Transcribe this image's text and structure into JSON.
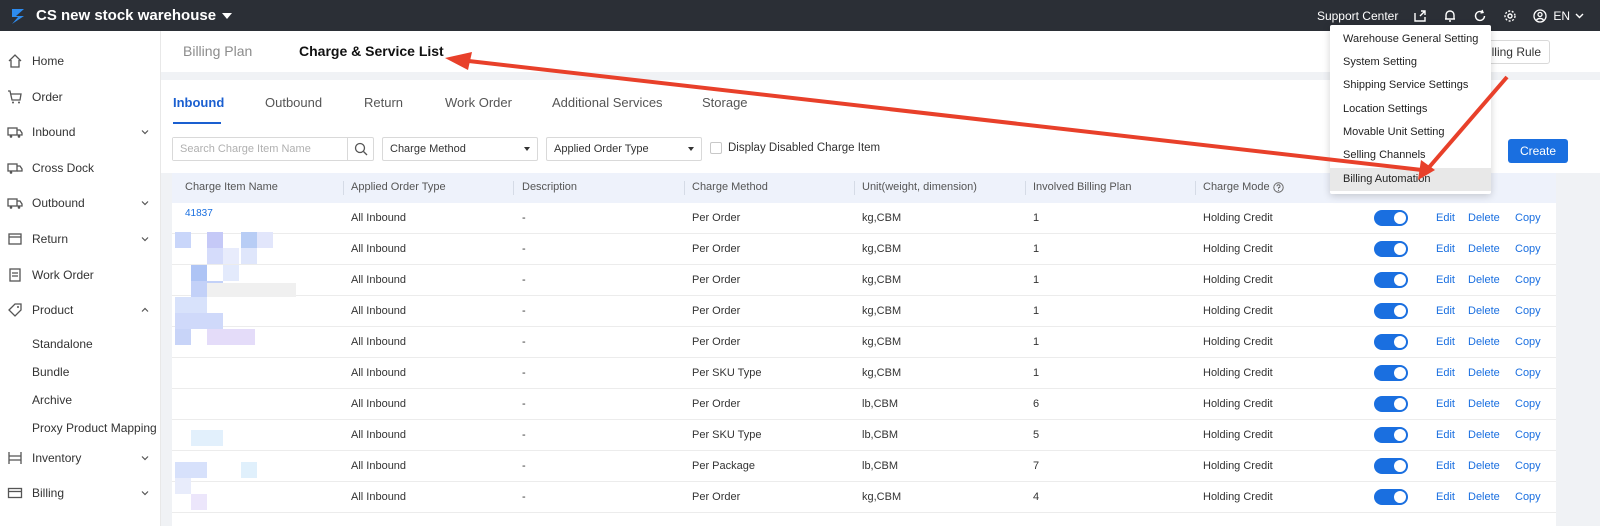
{
  "topbar": {
    "warehouse": "CS new stock warehouse",
    "support": "Support Center",
    "lang": "EN"
  },
  "sidebar": {
    "items": [
      {
        "label": "Home"
      },
      {
        "label": "Order"
      },
      {
        "label": "Inbound"
      },
      {
        "label": "Cross Dock"
      },
      {
        "label": "Outbound"
      },
      {
        "label": "Return"
      },
      {
        "label": "Work Order"
      },
      {
        "label": "Product"
      },
      {
        "label": "Inventory"
      },
      {
        "label": "Billing"
      }
    ],
    "product_sub": [
      "Standalone",
      "Bundle",
      "Archive",
      "Proxy Product Mapping"
    ]
  },
  "subhead": {
    "billing_plan": "Billing Plan",
    "charge_list": "Charge & Service List",
    "billing_rule": "Billing Rule"
  },
  "tabs": [
    "Inbound",
    "Outbound",
    "Return",
    "Work Order",
    "Additional Services",
    "Storage"
  ],
  "filters": {
    "search_placeholder": "Search Charge Item Name",
    "charge_method": "Charge Method",
    "applied_order_type": "Applied Order Type",
    "display_disabled": "Display Disabled Charge Item",
    "create": "Create"
  },
  "table": {
    "headers": [
      "Charge Item Name",
      "Applied Order Type",
      "Description",
      "Charge Method",
      "Unit(weight, dimension)",
      "Involved Billing Plan",
      "Charge Mode"
    ],
    "first_name": "41837",
    "actions": {
      "edit": "Edit",
      "delete": "Delete",
      "copy": "Copy"
    },
    "rows": [
      {
        "type": "All Inbound",
        "desc": "-",
        "method": "Per Order",
        "unit": "kg,CBM",
        "plans": "1",
        "mode": "Holding Credit"
      },
      {
        "type": "All Inbound",
        "desc": "-",
        "method": "Per Order",
        "unit": "kg,CBM",
        "plans": "1",
        "mode": "Holding Credit"
      },
      {
        "type": "All Inbound",
        "desc": "-",
        "method": "Per Order",
        "unit": "kg,CBM",
        "plans": "1",
        "mode": "Holding Credit"
      },
      {
        "type": "All Inbound",
        "desc": "-",
        "method": "Per Order",
        "unit": "kg,CBM",
        "plans": "1",
        "mode": "Holding Credit"
      },
      {
        "type": "All Inbound",
        "desc": "-",
        "method": "Per Order",
        "unit": "kg,CBM",
        "plans": "1",
        "mode": "Holding Credit"
      },
      {
        "type": "All Inbound",
        "desc": "-",
        "method": "Per SKU Type",
        "unit": "kg,CBM",
        "plans": "1",
        "mode": "Holding Credit"
      },
      {
        "type": "All Inbound",
        "desc": "-",
        "method": "Per Order",
        "unit": "lb,CBM",
        "plans": "6",
        "mode": "Holding Credit"
      },
      {
        "type": "All Inbound",
        "desc": "-",
        "method": "Per SKU Type",
        "unit": "lb,CBM",
        "plans": "5",
        "mode": "Holding Credit"
      },
      {
        "type": "All Inbound",
        "desc": "-",
        "method": "Per Package",
        "unit": "lb,CBM",
        "plans": "7",
        "mode": "Holding Credit"
      },
      {
        "type": "All Inbound",
        "desc": "-",
        "method": "Per Order",
        "unit": "kg,CBM",
        "plans": "4",
        "mode": "Holding Credit"
      }
    ]
  },
  "settings_menu": [
    "Warehouse General Setting",
    "System Setting",
    "Shipping Service Settings",
    "Location Settings",
    "Movable Unit Setting",
    "Selling Channels",
    "Billing Automation"
  ],
  "colors": {
    "accent": "#1a6fe0",
    "topbar": "#2b2f36",
    "annotation": "#e8402a"
  }
}
